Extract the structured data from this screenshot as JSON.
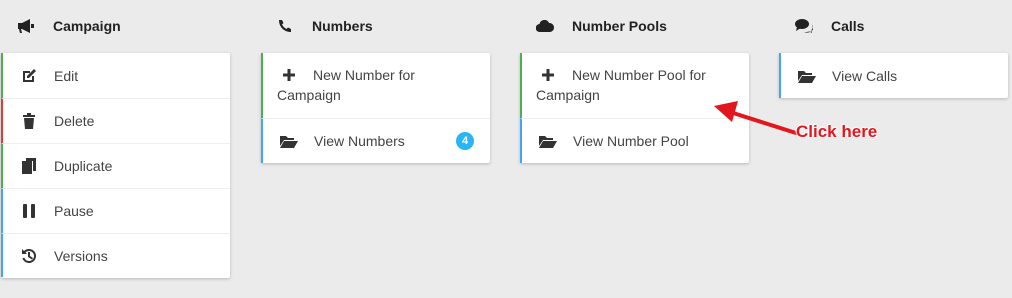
{
  "columns": {
    "campaign": {
      "title": "Campaign",
      "items": [
        {
          "label": "Edit"
        },
        {
          "label": "Delete"
        },
        {
          "label": "Duplicate"
        },
        {
          "label": "Pause"
        },
        {
          "label": "Versions"
        }
      ]
    },
    "numbers": {
      "title": "Numbers",
      "items": [
        {
          "label": "New Number for Campaign"
        },
        {
          "label": "View Numbers",
          "badge": "4"
        }
      ]
    },
    "number_pools": {
      "title": "Number Pools",
      "items": [
        {
          "label": "New Number Pool for Campaign"
        },
        {
          "label": "View Number Pool"
        }
      ]
    },
    "calls": {
      "title": "Calls",
      "items": [
        {
          "label": "View Calls"
        }
      ]
    }
  },
  "annotation": {
    "text": "Click here",
    "color": "#e3161e"
  },
  "colors": {
    "green": "#4caf50",
    "red": "#e53935",
    "blue": "#42a5f5",
    "badge": "#29b6f6"
  }
}
